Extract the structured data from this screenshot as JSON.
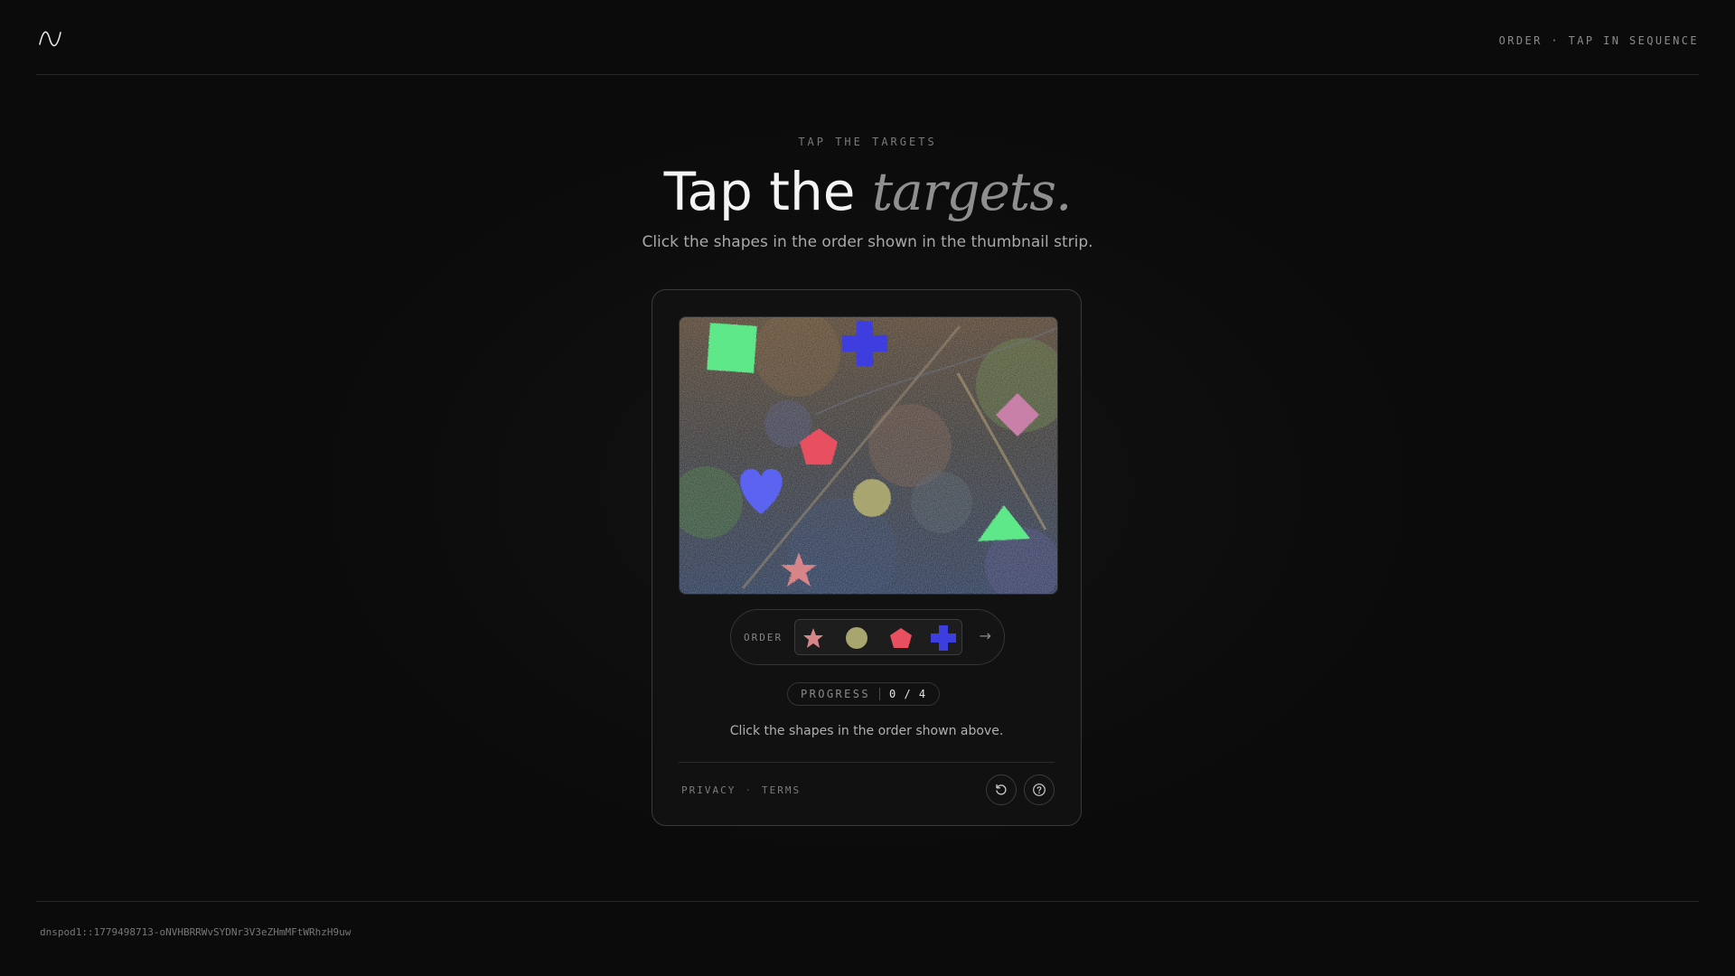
{
  "header": {
    "logo_icon": "wave-logo-icon",
    "mode_label": "ORDER · TAP IN SEQUENCE"
  },
  "hero": {
    "eyebrow": "TAP THE TARGETS",
    "title_plain": "Tap the ",
    "title_emphasis": "targets.",
    "subtitle": "Click the shapes in the order shown in the thumbnail strip."
  },
  "challenge": {
    "canvas_shapes": [
      "green-square",
      "blue-cross",
      "pink-diamond",
      "red-pentagon",
      "blue-heart",
      "olive-circle",
      "green-triangle",
      "pink-star"
    ],
    "order_label": "ORDER",
    "order_sequence": [
      "star-icon",
      "circle-icon",
      "pentagon-icon",
      "cross-icon"
    ],
    "order_arrow": "→",
    "progress_label": "PROGRESS",
    "progress_value": "0 / 4",
    "progress_current": 0,
    "progress_total": 4,
    "instruction": "Click the shapes in the order shown above."
  },
  "card_footer": {
    "privacy": "PRIVACY",
    "separator": "·",
    "terms": "TERMS",
    "refresh_icon": "refresh-icon",
    "help_icon": "help-icon"
  },
  "footer": {
    "token": "dnspod1::1779498713-oNVHBRRWvSYDNr3V3eZHmMFtWRhzH9uw"
  },
  "colors": {
    "background": "#0b0b0b",
    "green": "#5fe88a",
    "blue": "#3d3ee0",
    "red": "#e85060",
    "pink": "#c87fa8",
    "olive": "#a9a56f"
  }
}
